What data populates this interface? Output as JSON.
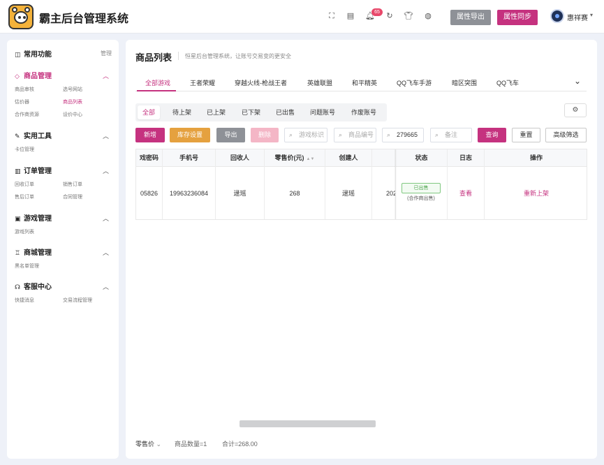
{
  "app": {
    "title": "霸主后台管理系统"
  },
  "header": {
    "icons": [
      "fullscreen-icon",
      "document-icon",
      "bell-icon",
      "refresh-icon",
      "shirt-icon",
      "palette-icon"
    ],
    "notification_count": "65",
    "export_button": "属性导出",
    "sync_button": "属性同步",
    "username": "惠祥赛"
  },
  "sidebar": {
    "common": {
      "label": "常用功能",
      "manage": "管理"
    },
    "sections": [
      {
        "label": "商品管理",
        "items": [
          "商品审核",
          "选号网站",
          "估价器",
          "商品列表",
          "合作商资源",
          "设价中心"
        ]
      },
      {
        "label": "实用工具",
        "items": [
          "卡位管理"
        ]
      },
      {
        "label": "订单管理",
        "items": [
          "回收订单",
          "销售订单",
          "售后订单",
          "合同管理"
        ]
      },
      {
        "label": "游戏管理",
        "items": [
          "游戏列表"
        ]
      },
      {
        "label": "商城管理",
        "items": [
          "黑名单管理"
        ]
      },
      {
        "label": "客服中心",
        "items": [
          "快捷消息",
          "交易流程管理"
        ]
      }
    ]
  },
  "page": {
    "title": "商品列表",
    "subtitle": "恒星后台管理系统，让账号交易变的更安全"
  },
  "game_tabs": [
    "全部游戏",
    "王者荣耀",
    "穿越火线-枪战王者",
    "英雄联盟",
    "和平精英",
    "QQ飞车手游",
    "暗区突围",
    "QQ飞车"
  ],
  "status_tabs": [
    "全部",
    "待上架",
    "已上架",
    "已下架",
    "已出售",
    "问题账号",
    "作废账号"
  ],
  "toolbar": {
    "add": "新增",
    "stock": "库存设置",
    "export": "导出",
    "delete": "删除",
    "game_placeholder": "游戏标识",
    "code_placeholder": "商品编号",
    "search_value": "279665",
    "remark_placeholder": "备注",
    "query": "查询",
    "reset": "重置",
    "advanced": "高级筛选"
  },
  "table": {
    "headers": [
      "戏密码",
      "手机号",
      "回收人",
      "零售价(元)",
      "创建人",
      "",
      "状态",
      "日志",
      "操作"
    ],
    "row": {
      "password": "05826",
      "phone": "19963236084",
      "recycler": "逯瑶",
      "price": "268",
      "creator": "逯瑶",
      "date_partial": "202",
      "status": "已出售",
      "status_note": "(合作商出售)",
      "log": "查看",
      "action": "重新上架"
    }
  },
  "footer": {
    "retail_label": "零售价",
    "count": "商品数量=1",
    "total": "合计=268.00"
  },
  "colors": {
    "accent": "#c5327f",
    "gray_button": "#8e9197",
    "orange": "#e5a13f",
    "disabled": "#f4b6c6"
  }
}
